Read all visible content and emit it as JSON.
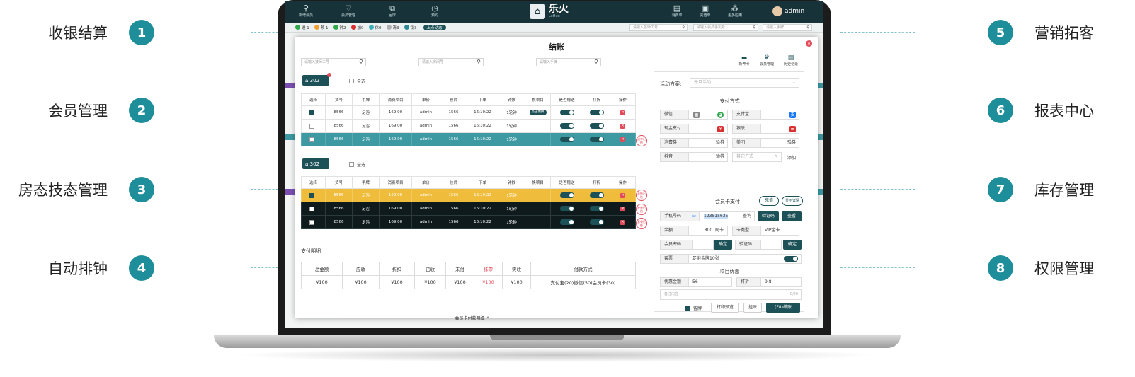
{
  "features_left": [
    {
      "num": "1",
      "label": "收银结算"
    },
    {
      "num": "2",
      "label": "会员管理"
    },
    {
      "num": "3",
      "label": "房态技态管理"
    },
    {
      "num": "4",
      "label": "自动排钟"
    }
  ],
  "features_right": [
    {
      "num": "5",
      "label": "营销拓客"
    },
    {
      "num": "6",
      "label": "报表中心"
    },
    {
      "num": "7",
      "label": "库存管理"
    },
    {
      "num": "8",
      "label": "权限管理"
    }
  ],
  "topnav": [
    {
      "label": "新增会员",
      "icon": "user-plus-icon"
    },
    {
      "label": "会员管理",
      "icon": "heart-icon"
    },
    {
      "label": "届床",
      "icon": "bed-icon"
    },
    {
      "label": "预约",
      "icon": "clock-icon"
    }
  ],
  "topnav_right": [
    {
      "label": "消费单",
      "icon": "receipt-icon"
    },
    {
      "label": "充值单",
      "icon": "wallet-icon"
    },
    {
      "label": "更多应用",
      "icon": "apps-icon"
    }
  ],
  "brand": {
    "name": "乐火",
    "sub": "LeHuo"
  },
  "user": {
    "name": "admin"
  },
  "status_bar": {
    "items": [
      {
        "label": "进 1",
        "color": "#2ea84a"
      },
      {
        "label": "预 1",
        "color": "#f0a030"
      },
      {
        "label": "钟2",
        "color": "#2ea84a"
      },
      {
        "label": "加0",
        "color": "#d93030"
      },
      {
        "label": "休0",
        "color": "#3fb0b8"
      },
      {
        "label": "清3",
        "color": "#b0b0b0"
      },
      {
        "label": "锁3",
        "color": "#2b8a94"
      }
    ],
    "live_label": "上点动态",
    "search_tech": "请输入技师工号",
    "search_member": "请输入会员手机号",
    "search_hand": "请输入手牌"
  },
  "modal": {
    "title": "结账",
    "search_tech": "请输入技师工号",
    "search_room": "请输入房间号",
    "search_hand": "请输入手牌",
    "tools": [
      "新开卡",
      "会员管理",
      "历史记录"
    ],
    "select_all": "全选",
    "columns": [
      "选择",
      "货号",
      "手牌",
      "消费项目",
      "单价",
      "技师",
      "下单",
      "钟数",
      "换项目",
      "是否赠送",
      "打折",
      "操作"
    ],
    "group1": {
      "room": "302",
      "rows": [
        {
          "no": "8566",
          "hand": "足浴",
          "item": "169.00",
          "by": "admin",
          "tech": "1566",
          "time": "16:10:22",
          "clock": "1轮钟",
          "swap": "点击更换",
          "checked": true,
          "style": ""
        },
        {
          "no": "8566",
          "hand": "足浴",
          "item": "169.00",
          "by": "admin",
          "tech": "1566",
          "time": "16:10:22",
          "clock": "1轮钟",
          "swap": "",
          "checked": false,
          "style": ""
        },
        {
          "no": "8566",
          "hand": "足浴",
          "item": "169.00",
          "by": "admin",
          "tech": "1566",
          "time": "16:10:22",
          "clock": "1轮钟",
          "swap": "",
          "checked": false,
          "style": "r-teal",
          "stamp": "退单已结"
        }
      ]
    },
    "group2": {
      "room": "302",
      "rows": [
        {
          "no": "8566",
          "hand": "足浴",
          "item": "169.00",
          "by": "admin",
          "tech": "1566",
          "time": "16:10:22",
          "clock": "1轮钟",
          "swap": "",
          "checked": true,
          "style": "r-yellow",
          "stamp": "未结已结"
        },
        {
          "no": "8566",
          "hand": "足浴",
          "item": "169.00",
          "by": "admin",
          "tech": "1566",
          "time": "16:10:22",
          "clock": "1轮钟",
          "swap": "",
          "checked": false,
          "style": "r-dark",
          "stamp": "补单已结"
        },
        {
          "no": "8566",
          "hand": "足浴",
          "item": "169.00",
          "by": "admin",
          "tech": "1566",
          "time": "16:10:22",
          "clock": "1轮钟",
          "swap": "",
          "checked": false,
          "style": "r-dark",
          "stamp": "套餐已结"
        }
      ]
    },
    "pay_detail": {
      "title": "支付明细",
      "headers": [
        "总金额",
        "应收",
        "折扣",
        "已收",
        "未付",
        "抹零",
        "实收",
        "付款方式"
      ],
      "values": [
        "¥100",
        "¥100",
        "¥100",
        "¥100",
        "¥100",
        "¥100",
        "¥100",
        "支付宝(20)微信(50)会员卡(30)"
      ]
    },
    "member_link": "会员卡付款明细"
  },
  "panel": {
    "activity_label": "活动方案:",
    "activity_value": "元旦活动",
    "pay_title": "支付方式",
    "pay_methods": [
      {
        "label": "微信",
        "icon": "wechat-icon",
        "color": "#2ea84a"
      },
      {
        "label": "支付宝",
        "icon": "alipay-icon",
        "color": "#1677ff"
      },
      {
        "label": "现金支付",
        "icon": "cash-icon",
        "color": "#d93030"
      },
      {
        "label": "银联",
        "icon": "unionpay-icon",
        "color": "#d93030"
      },
      {
        "label": "消费券",
        "extra": "验券"
      },
      {
        "label": "美团",
        "extra": "验券"
      },
      {
        "label": "抖音",
        "extra": "验券"
      },
      {
        "label": "其它方式",
        "extra": "添加"
      }
    ],
    "member_title": "会员卡支付",
    "recharge": "充值",
    "show_detail": "显示详情",
    "phone_label": "手机号码",
    "phone_value": "123515635",
    "query": "查询",
    "verify_code_btn": "验证码",
    "check_btn": "查看",
    "balance_label": "余额",
    "balance_value": "800",
    "card_brush": "刷卡",
    "card_type_label": "卡类型",
    "card_type_value": "VIP金卡",
    "password_label": "会员密码",
    "confirm": "确定",
    "verify_label": "验证码",
    "confirm2": "确定",
    "package_label": "套票",
    "package_value": "足浴金牌10张",
    "discount_title": "项目优惠",
    "discount_amount_label": "优惠金额",
    "discount_amount_value": "56",
    "discount_rate_label": "打折",
    "discount_rate_value": "9.8",
    "remark_placeholder": "备注内容",
    "remark_count": "0/20",
    "keep_label": "留牌",
    "print_preview": "打印预览",
    "hang": "挂账",
    "checkout": "(F8)结账"
  }
}
